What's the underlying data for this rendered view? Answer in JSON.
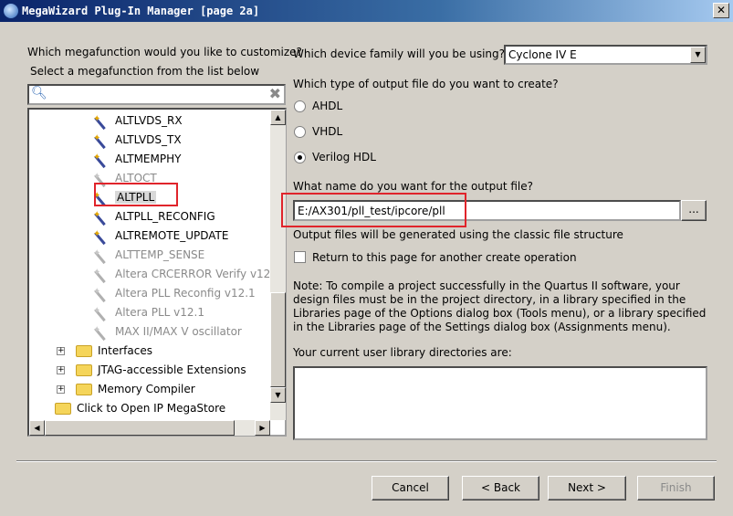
{
  "window": {
    "title": "MegaWizard Plug-In Manager [page 2a]",
    "close": "✕"
  },
  "left": {
    "question": "Which megafunction would you like to customize?",
    "instruction": "Select a megafunction from the list below",
    "search": {
      "value": "",
      "clear_icon": "✖"
    },
    "tree": [
      {
        "label": "ALTLVDS_RX",
        "enabled": true
      },
      {
        "label": "ALTLVDS_TX",
        "enabled": true
      },
      {
        "label": "ALTMEMPHY",
        "enabled": true
      },
      {
        "label": "ALTOCT",
        "enabled": false
      },
      {
        "label": "ALTPLL",
        "enabled": true,
        "selected": true
      },
      {
        "label": "ALTPLL_RECONFIG",
        "enabled": true
      },
      {
        "label": "ALTREMOTE_UPDATE",
        "enabled": true
      },
      {
        "label": "ALTTEMP_SENSE",
        "enabled": false
      },
      {
        "label": "Altera CRCERROR Verify v12.1",
        "enabled": false
      },
      {
        "label": "Altera PLL Reconfig v12.1",
        "enabled": false
      },
      {
        "label": "Altera PLL v12.1",
        "enabled": false
      },
      {
        "label": "MAX II/MAX V oscillator",
        "enabled": false
      }
    ],
    "folders": [
      "Interfaces",
      "JTAG-accessible Extensions",
      "Memory Compiler"
    ],
    "megastore": "Click to Open IP MegaStore"
  },
  "right": {
    "device_label": "Which device family will you be using?",
    "device_value": "Cyclone IV E",
    "output_type_label": "Which type of output file do you want to create?",
    "output_types": [
      {
        "label": "AHDL",
        "checked": false
      },
      {
        "label": "VHDL",
        "checked": false
      },
      {
        "label": "Verilog HDL",
        "checked": true
      }
    ],
    "output_name_label": "What name do you want for the output file?",
    "output_name_value": "E:/AX301/pll_test/ipcore/pll",
    "browse": "...",
    "structure_note": "Output files will be generated using the classic file structure",
    "return_checkbox": "Return to this page for another create operation",
    "note": "Note: To compile a project successfully in the Quartus II software, your design files must be in the project directory, in a library specified in the Libraries page of the Options dialog box (Tools menu), or a library specified in the Libraries page of the Settings dialog box (Assignments menu).",
    "library_label": "Your current user library directories are:"
  },
  "buttons": {
    "cancel": "Cancel",
    "back": "< Back",
    "next": "Next >",
    "finish": "Finish"
  },
  "colors": {
    "highlight": "#e0242b",
    "titlebar": "#0a246a"
  }
}
